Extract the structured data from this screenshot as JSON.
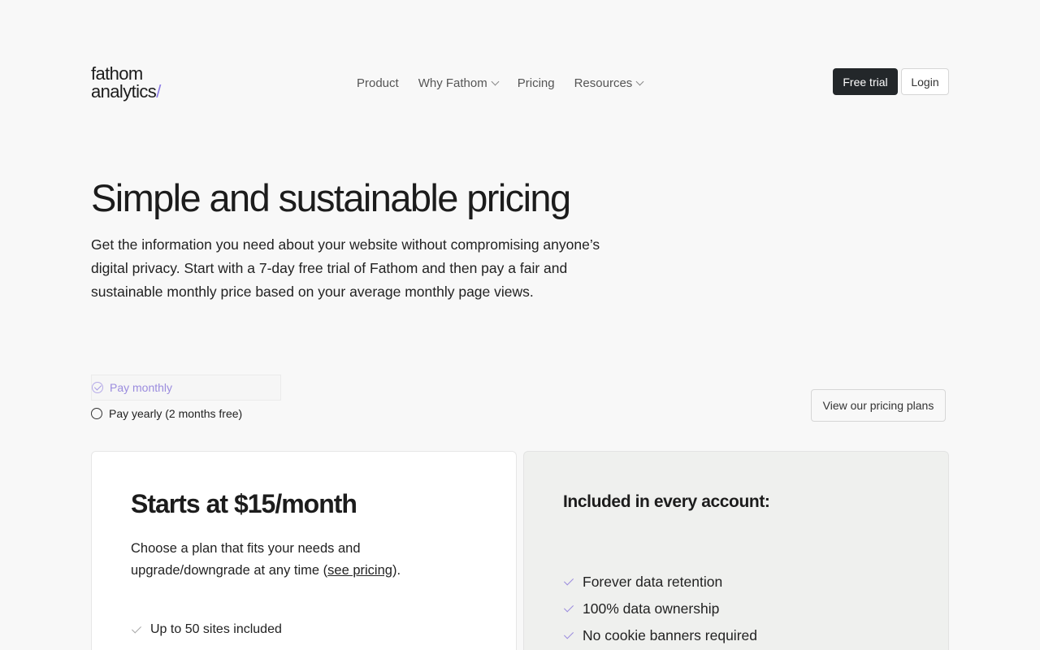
{
  "brand": {
    "line1": "fathom",
    "line2": "analytics",
    "slash": "/"
  },
  "nav": {
    "items": [
      {
        "label": "Product",
        "dropdown": false
      },
      {
        "label": "Why Fathom",
        "dropdown": true
      },
      {
        "label": "Pricing",
        "dropdown": false
      },
      {
        "label": "Resources",
        "dropdown": true
      }
    ]
  },
  "header": {
    "free_trial": "Free trial",
    "login": "Login"
  },
  "hero": {
    "title": "Simple and sustainable pricing",
    "subtitle": "Get the information you need about your website without compromising anyone’s digital privacy. Start with a 7-day free trial of Fathom and then pay a fair and sustainable monthly price based on your average monthly page views."
  },
  "billing": {
    "monthly": "Pay monthly",
    "yearly": "Pay yearly (2 months free)"
  },
  "plans_button": "View our pricing plans",
  "pricing_card": {
    "title": "Starts at $15/month",
    "desc_before": "Choose a plan that fits your needs and upgrade/downgrade at any time (",
    "desc_link": "see pricing",
    "desc_after": ").",
    "features": [
      "Up to 50 sites included"
    ]
  },
  "included_card": {
    "title": "Included in every account:",
    "items": [
      "Forever data retention",
      "100% data ownership",
      "No cookie banners required"
    ]
  },
  "colors": {
    "accent": "#8c7ce6",
    "dark_button": "#23272a",
    "background": "#f8f8f8"
  }
}
